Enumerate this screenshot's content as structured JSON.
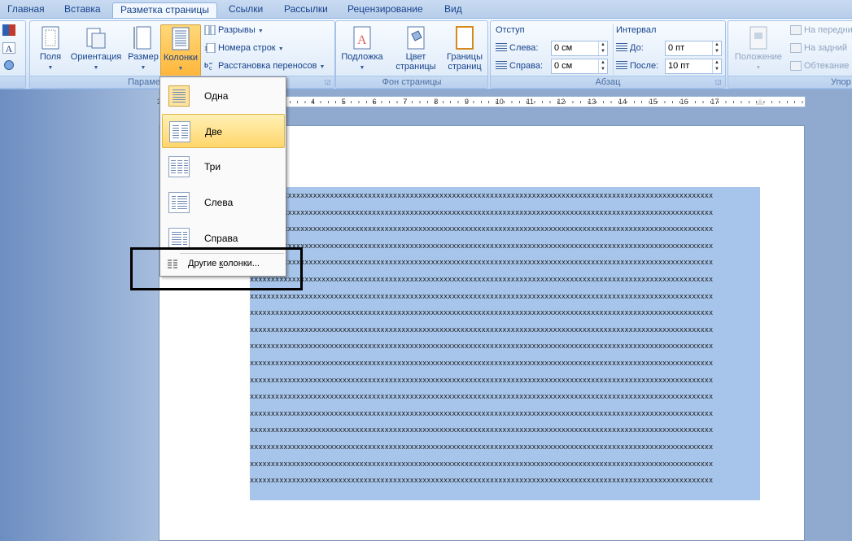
{
  "tabs": [
    "Главная",
    "Вставка",
    "Разметка страницы",
    "Ссылки",
    "Рассылки",
    "Рецензирование",
    "Вид"
  ],
  "active_tab_index": 2,
  "groups": {
    "page_setup": {
      "label": "Параме",
      "buttons": {
        "fields": "Поля",
        "orientation": "Ориентация",
        "size": "Размер",
        "columns": "Колонки"
      },
      "small": {
        "breaks": "Разрывы",
        "line_numbers": "Номера строк",
        "hyphenation": "Расстановка переносов"
      }
    },
    "page_background": {
      "label": "Фон страницы",
      "buttons": {
        "watermark": "Подложка",
        "page_color_line1": "Цвет",
        "page_color_line2": "страницы",
        "page_borders_line1": "Границы",
        "page_borders_line2": "страниц"
      }
    },
    "paragraph": {
      "label": "Абзац",
      "indent_title": "Отступ",
      "left_label": "Слева:",
      "left_value": "0 см",
      "right_label": "Справа:",
      "right_value": "0 см",
      "spacing_title": "Интервал",
      "before_label": "До:",
      "before_value": "0 пт",
      "after_label": "После:",
      "after_value": "10 пт"
    },
    "arrange": {
      "label": "Упор",
      "position": "Положение",
      "bring_forward": "На передни",
      "send_backward": "На задний",
      "wrap": "Обтекание"
    }
  },
  "ruler_numbers": [
    "3",
    "1",
    "1",
    "2",
    "3",
    "4",
    "5",
    "6",
    "7",
    "8",
    "9",
    "10",
    "11",
    "12",
    "13",
    "14",
    "15",
    "16",
    "17"
  ],
  "columns_menu": {
    "items": [
      "Одна",
      "Две",
      "Три",
      "Слева",
      "Справа"
    ],
    "highlighted_index": 1,
    "selected_index": 0,
    "more_prefix": "Другие ",
    "more_underline": "к",
    "more_suffix": "олонки..."
  },
  "document": {
    "line_text": "xxxxxxxxxxxxxxxxxxxxxxxxxxxxxxxxxxxxxxxxxxxxxxxxxxxxxxxxxxxxxxxxxxxxxxxxxxxxxxxxxxxxxxxxxxxxxxxxxxxxxxxxxxxxxx",
    "line_count": 18
  },
  "colors": {
    "selection": "#a7c5ea",
    "ribbon": "#dde9f7",
    "accent": "#ffd66b",
    "text": "#15428b"
  }
}
